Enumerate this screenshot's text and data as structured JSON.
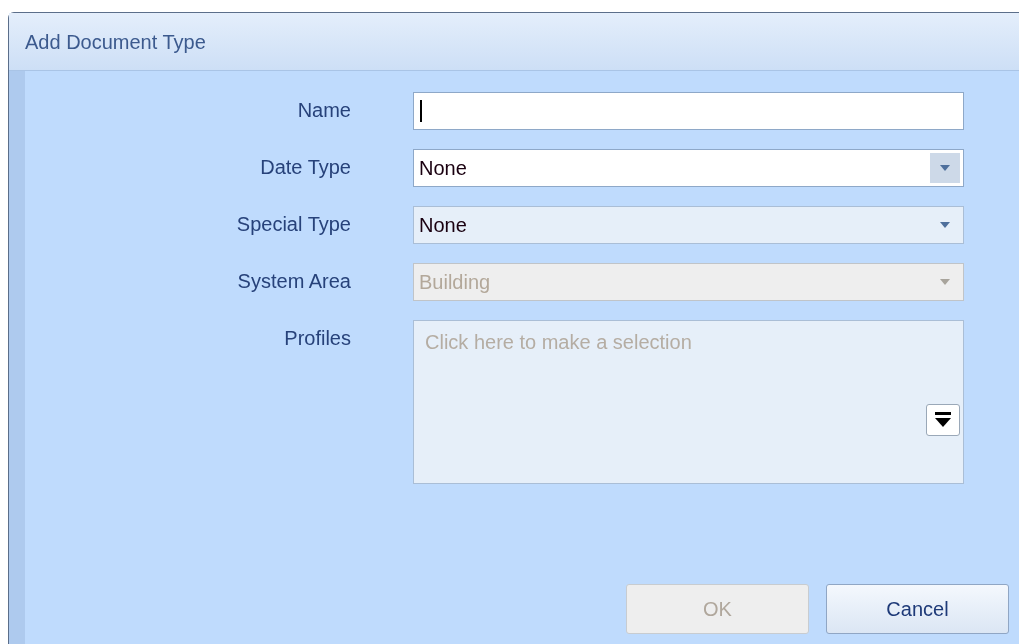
{
  "window": {
    "title": "Add Document Type"
  },
  "fields": [
    {
      "label": "Name",
      "kind": "text",
      "focused": true,
      "disabled": false
    },
    {
      "label": "Date Type",
      "kind": "dropdown",
      "value": "None",
      "focused": true,
      "disabled": false
    },
    {
      "label": "Special Type",
      "kind": "dropdown",
      "value": "None",
      "focused": false,
      "disabled": false
    },
    {
      "label": "System Area",
      "kind": "dropdown",
      "value": "Building",
      "focused": false,
      "disabled": true
    },
    {
      "label": "Profiles",
      "kind": "multiselect",
      "placeholder": "Click here to make a selection",
      "focused": false,
      "disabled": false
    }
  ],
  "buttons": [
    {
      "label": "OK",
      "disabled": true
    },
    {
      "label": "Cancel",
      "disabled": false
    }
  ]
}
